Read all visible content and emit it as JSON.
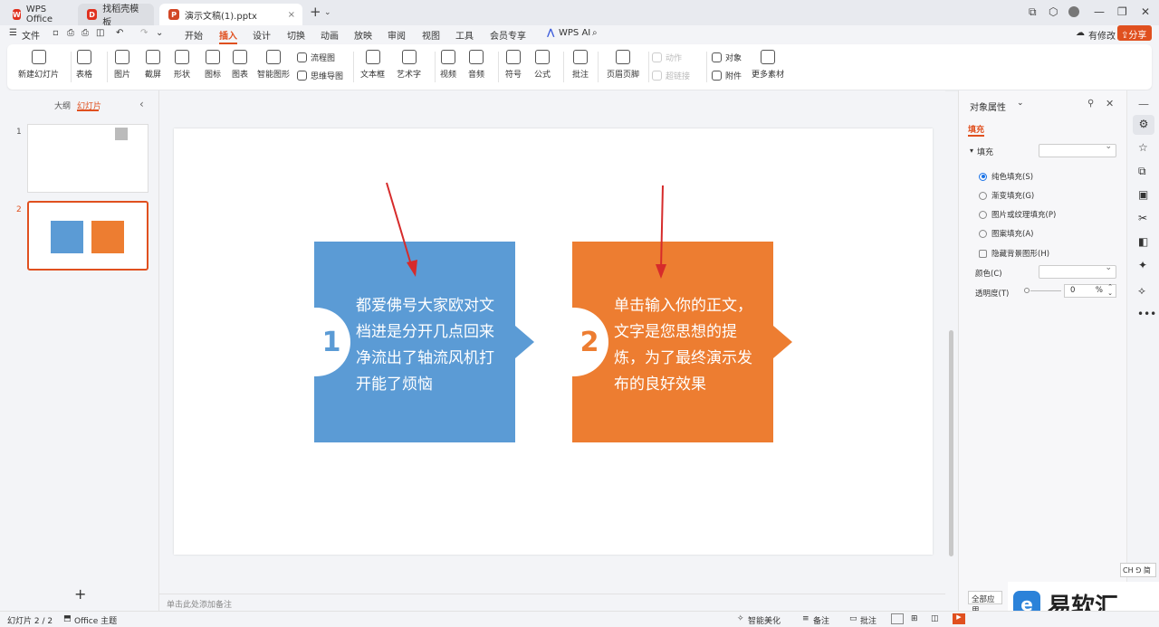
{
  "tabs": [
    {
      "label": "WPS Office",
      "color": "#e0301e"
    },
    {
      "label": "找稻壳模板",
      "color": "#e0301e"
    },
    {
      "label": "演示文稿(1).pptx",
      "color": "#d24726"
    }
  ],
  "menu": {
    "file": "文件",
    "items": [
      "开始",
      "插入",
      "设计",
      "切换",
      "动画",
      "放映",
      "审阅",
      "视图",
      "工具",
      "会员专享"
    ],
    "active": "插入",
    "wps_ai": "WPS AI",
    "has_changes": "有修改",
    "share": "分享"
  },
  "ribbon": {
    "new_slide": "新建幻灯片",
    "table": "表格",
    "picture": "图片",
    "screenshot": "截屏",
    "shape": "形状",
    "icon": "图标",
    "chart": "图表",
    "smart_shape": "智能图形",
    "flowchart": "流程图",
    "mindmap": "思维导图",
    "textbox": "文本框",
    "wordart": "艺术字",
    "video": "视频",
    "audio": "音频",
    "symbol": "符号",
    "formula": "公式",
    "comment": "批注",
    "header_footer": "页眉页脚",
    "action": "动作",
    "hyperlink": "超链接",
    "object": "对象",
    "attachment": "附件",
    "more_material": "更多素材"
  },
  "left_panel": {
    "outline": "大纲",
    "slides": "幻灯片",
    "thumb_numbers": [
      "1",
      "2"
    ]
  },
  "slide": {
    "card1": {
      "number": "1",
      "text": "都爱佛号大家欧对文档进是分开几点回来净流出了轴流风机打开能了烦恼",
      "color": "#5b9bd5"
    },
    "card2": {
      "number": "2",
      "text": "单击输入你的正文，文字是您思想的提炼，为了最终演示发布的良好效果",
      "color": "#ed7d31"
    }
  },
  "notes_placeholder": "单击此处添加备注",
  "right_panel": {
    "title": "对象属性",
    "tab_fill": "填充",
    "section_fill": "填充",
    "options": [
      "纯色填充(S)",
      "渐变填充(G)",
      "图片或纹理填充(P)",
      "图案填充(A)"
    ],
    "hide_bg": "隐藏背景图形(H)",
    "color_label": "颜色(C)",
    "transparency_label": "透明度(T)",
    "transparency_value": "0",
    "percent": "%",
    "apply_all": "全部应用"
  },
  "status": {
    "slide_count": "幻灯片 2 / 2",
    "theme": "Office 主题",
    "smart_beautify": "智能美化",
    "notes": "备注",
    "comments": "批注",
    "ime": "CH ⅁ 简"
  },
  "watermark": "易软汇"
}
